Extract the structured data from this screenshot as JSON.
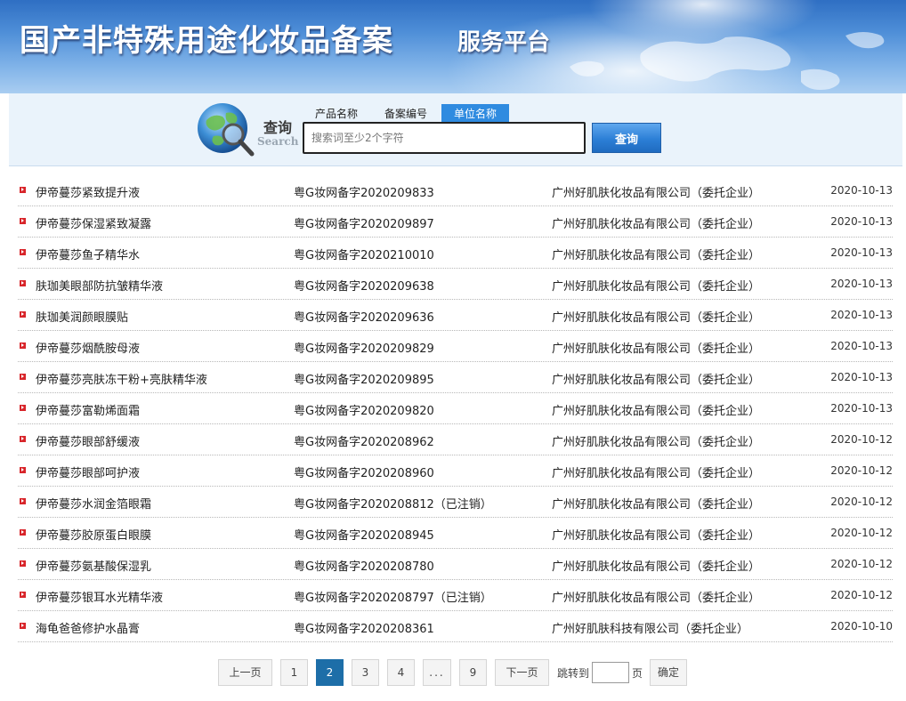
{
  "banner": {
    "title": "国产非特殊用途化妆品备案",
    "subtitle": "服务平台"
  },
  "search": {
    "query_cn": "查询",
    "query_en": "Search",
    "tabs": [
      {
        "label": "产品名称",
        "active": false
      },
      {
        "label": "备案编号",
        "active": false
      },
      {
        "label": "单位名称",
        "active": true
      }
    ],
    "placeholder": "搜索词至少2个字符",
    "button_label": "查询",
    "accent_color": "#2f8be0"
  },
  "results": [
    {
      "name": "伊帝蔓莎紧致提升液",
      "code": "粤G妆网备字2020209833",
      "company": "广州好肌肤化妆品有限公司（委托企业）",
      "date": "2020-10-13"
    },
    {
      "name": "伊帝蔓莎保湿紧致凝露",
      "code": "粤G妆网备字2020209897",
      "company": "广州好肌肤化妆品有限公司（委托企业）",
      "date": "2020-10-13"
    },
    {
      "name": "伊帝蔓莎鱼子精华水",
      "code": "粤G妆网备字2020210010",
      "company": "广州好肌肤化妆品有限公司（委托企业）",
      "date": "2020-10-13"
    },
    {
      "name": "肤珈美眼部防抗皱精华液",
      "code": "粤G妆网备字2020209638",
      "company": "广州好肌肤化妆品有限公司（委托企业）",
      "date": "2020-10-13"
    },
    {
      "name": "肤珈美润颜眼膜贴",
      "code": "粤G妆网备字2020209636",
      "company": "广州好肌肤化妆品有限公司（委托企业）",
      "date": "2020-10-13"
    },
    {
      "name": "伊帝蔓莎烟酰胺母液",
      "code": "粤G妆网备字2020209829",
      "company": "广州好肌肤化妆品有限公司（委托企业）",
      "date": "2020-10-13"
    },
    {
      "name": "伊帝蔓莎亮肤冻干粉+亮肤精华液",
      "code": "粤G妆网备字2020209895",
      "company": "广州好肌肤化妆品有限公司（委托企业）",
      "date": "2020-10-13"
    },
    {
      "name": "伊帝蔓莎富勒烯面霜",
      "code": "粤G妆网备字2020209820",
      "company": "广州好肌肤化妆品有限公司（委托企业）",
      "date": "2020-10-13"
    },
    {
      "name": "伊帝蔓莎眼部舒缓液",
      "code": "粤G妆网备字2020208962",
      "company": "广州好肌肤化妆品有限公司（委托企业）",
      "date": "2020-10-12"
    },
    {
      "name": "伊帝蔓莎眼部呵护液",
      "code": "粤G妆网备字2020208960",
      "company": "广州好肌肤化妆品有限公司（委托企业）",
      "date": "2020-10-12"
    },
    {
      "name": "伊帝蔓莎水润金箔眼霜",
      "code": "粤G妆网备字2020208812（已注销）",
      "company": "广州好肌肤化妆品有限公司（委托企业）",
      "date": "2020-10-12"
    },
    {
      "name": "伊帝蔓莎胶原蛋白眼膜",
      "code": "粤G妆网备字2020208945",
      "company": "广州好肌肤化妆品有限公司（委托企业）",
      "date": "2020-10-12"
    },
    {
      "name": "伊帝蔓莎氨基酸保湿乳",
      "code": "粤G妆网备字2020208780",
      "company": "广州好肌肤化妆品有限公司（委托企业）",
      "date": "2020-10-12"
    },
    {
      "name": "伊帝蔓莎银耳水光精华液",
      "code": "粤G妆网备字2020208797（已注销）",
      "company": "广州好肌肤化妆品有限公司（委托企业）",
      "date": "2020-10-12"
    },
    {
      "name": "海龟爸爸修护水晶膏",
      "code": "粤G妆网备字2020208361",
      "company": "广州好肌肤科技有限公司（委托企业）",
      "date": "2020-10-10"
    }
  ],
  "pagination": {
    "prev_label": "上一页",
    "pages": [
      "1",
      "2",
      "3",
      "4",
      "...",
      "9"
    ],
    "current_page": "2",
    "next_label": "下一页",
    "jump_label": "跳转到",
    "jump_value": "",
    "page_unit": "页",
    "confirm_label": "确定",
    "current_color": "#1d6ea8"
  }
}
